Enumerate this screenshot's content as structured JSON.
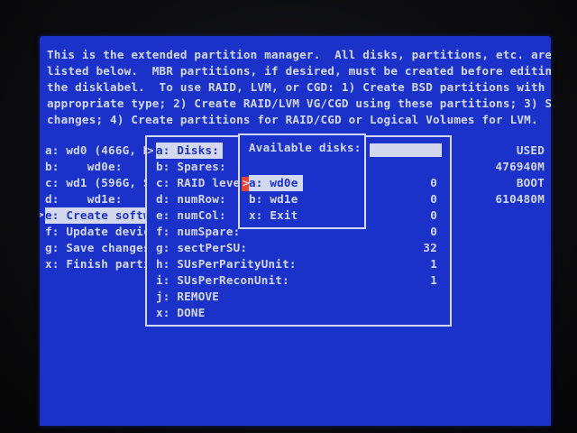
{
  "intro": {
    "lines": [
      "This is the extended partition manager.  All disks, partitions, etc. are",
      "listed below.  MBR partitions, if desired, must be created before editing",
      "the disklabel.  To use RAID, LVM, or CGD: 1) Create BSD partitions with the",
      "appropriate type; 2) Create RAID/LVM VG/CGD using these partitions; 3) Save",
      "changes; 4) Create partitions for RAID/CGD or Logical Volumes for LVM."
    ]
  },
  "main_menu": {
    "items": [
      "a: wd0 (466G, M",
      "b:    wd0e:",
      "c: wd1 (596G, S",
      "d:    wd1e:",
      "e: Create softw",
      "f: Update devic",
      "g: Save changes",
      "x: Finish parti"
    ],
    "selected_index": 4
  },
  "used_column": {
    "header": "USED",
    "values": [
      "476940M",
      "BOOT",
      "610480M"
    ]
  },
  "raid_dialog": {
    "rows": [
      {
        "label": "a: Disks:",
        "value": ""
      },
      {
        "label": "b: Spares:",
        "value": ""
      },
      {
        "label": "c: RAID leve",
        "value": "0"
      },
      {
        "label": "d: numRow:",
        "value": "0"
      },
      {
        "label": "e: numCol:",
        "value": "0"
      },
      {
        "label": "f: numSpare:",
        "value": "0"
      },
      {
        "label": "g: sectPerSU:",
        "value": "32"
      },
      {
        "label": "h: SUsPerParityUnit:",
        "value": "1"
      },
      {
        "label": "i: SUsPerReconUnit:",
        "value": "1"
      },
      {
        "label": "j: REMOVE",
        "value": ""
      },
      {
        "label": "x: DONE",
        "value": ""
      }
    ],
    "selected_index": 0
  },
  "disks_popup": {
    "title": "Available disks:",
    "options": [
      "a: wd0e",
      "b: wd1e",
      "x: Exit"
    ],
    "selected_index": 0
  },
  "arrows": {
    "main": ">",
    "raid": ">",
    "popup": ">"
  },
  "colors": {
    "screen_bg": "#1a32c9",
    "text": "#d4d8ee",
    "marker": "#e8442e"
  }
}
